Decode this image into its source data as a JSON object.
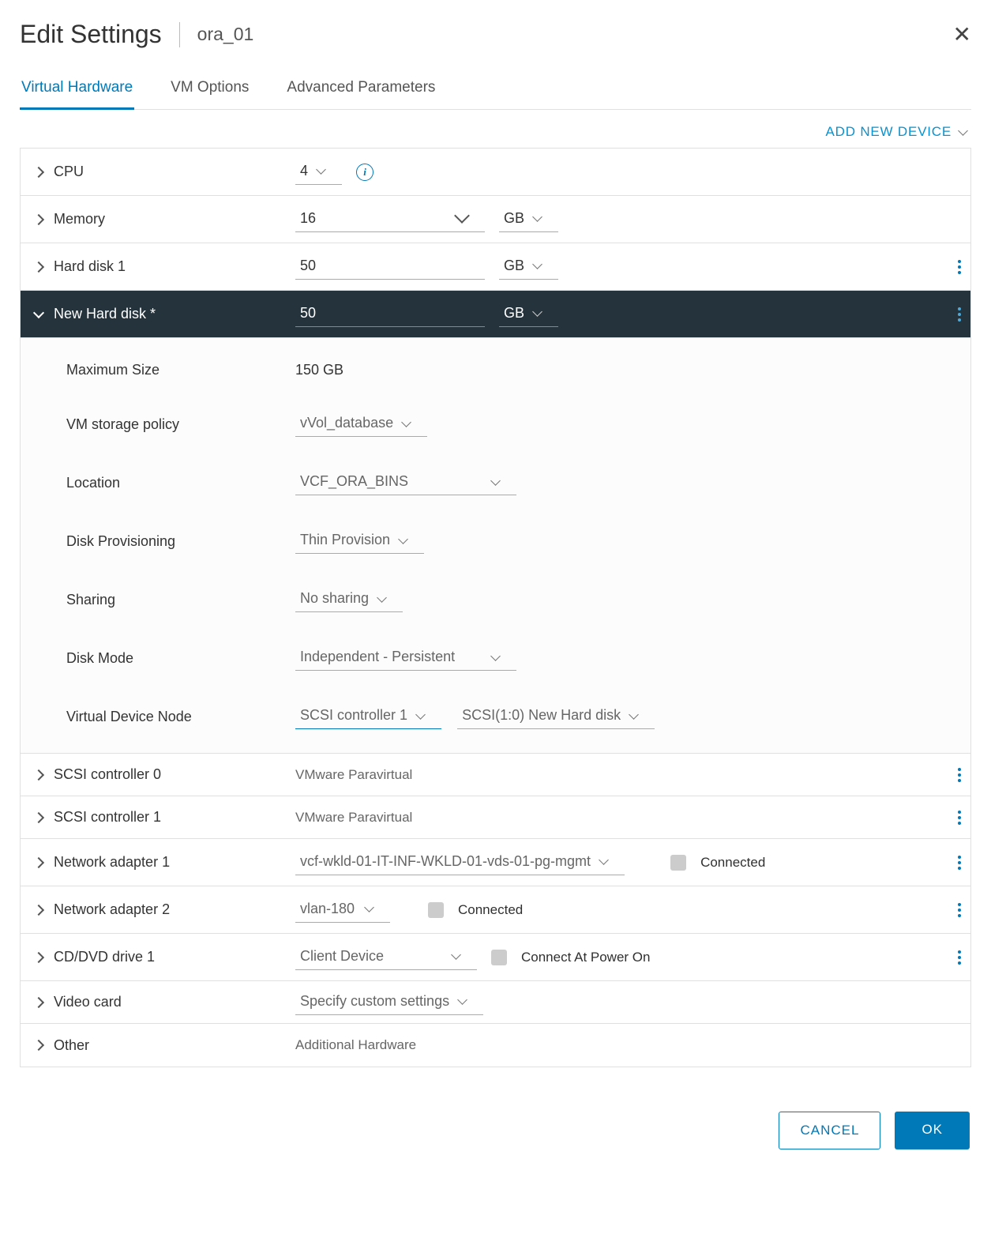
{
  "dialog": {
    "title": "Edit Settings",
    "subtitle": "ora_01"
  },
  "tabs": {
    "hardware": "Virtual Hardware",
    "options": "VM Options",
    "advanced": "Advanced Parameters"
  },
  "add_device": "ADD NEW DEVICE",
  "cpu": {
    "label": "CPU",
    "value": "4"
  },
  "memory": {
    "label": "Memory",
    "value": "16",
    "unit": "GB"
  },
  "hd1": {
    "label": "Hard disk 1",
    "value": "50",
    "unit": "GB"
  },
  "new_hd": {
    "label": "New Hard disk *",
    "value": "50",
    "unit": "GB"
  },
  "detail": {
    "max_size": {
      "label": "Maximum Size",
      "value": "150 GB"
    },
    "storage_policy": {
      "label": "VM storage policy",
      "value": "vVol_database"
    },
    "location": {
      "label": "Location",
      "value": "VCF_ORA_BINS"
    },
    "provisioning": {
      "label": "Disk Provisioning",
      "value": "Thin Provision"
    },
    "sharing": {
      "label": "Sharing",
      "value": "No sharing"
    },
    "disk_mode": {
      "label": "Disk Mode",
      "value": "Independent - Persistent"
    },
    "vdn": {
      "label": "Virtual Device Node",
      "controller": "SCSI controller 1",
      "slot": "SCSI(1:0) New Hard disk"
    }
  },
  "scsi0": {
    "label": "SCSI controller 0",
    "value": "VMware Paravirtual"
  },
  "scsi1": {
    "label": "SCSI controller 1",
    "value": "VMware Paravirtual"
  },
  "net1": {
    "label": "Network adapter 1",
    "value": "vcf-wkld-01-IT-INF-WKLD-01-vds-01-pg-mgmt",
    "connected": "Connected"
  },
  "net2": {
    "label": "Network adapter 2",
    "value": "vlan-180",
    "connected": "Connected"
  },
  "cd": {
    "label": "CD/DVD drive 1",
    "value": "Client Device",
    "connected": "Connect At Power On"
  },
  "video": {
    "label": "Video card",
    "value": "Specify custom settings"
  },
  "other": {
    "label": "Other",
    "value": "Additional Hardware"
  },
  "footer": {
    "cancel": "CANCEL",
    "ok": "OK"
  }
}
